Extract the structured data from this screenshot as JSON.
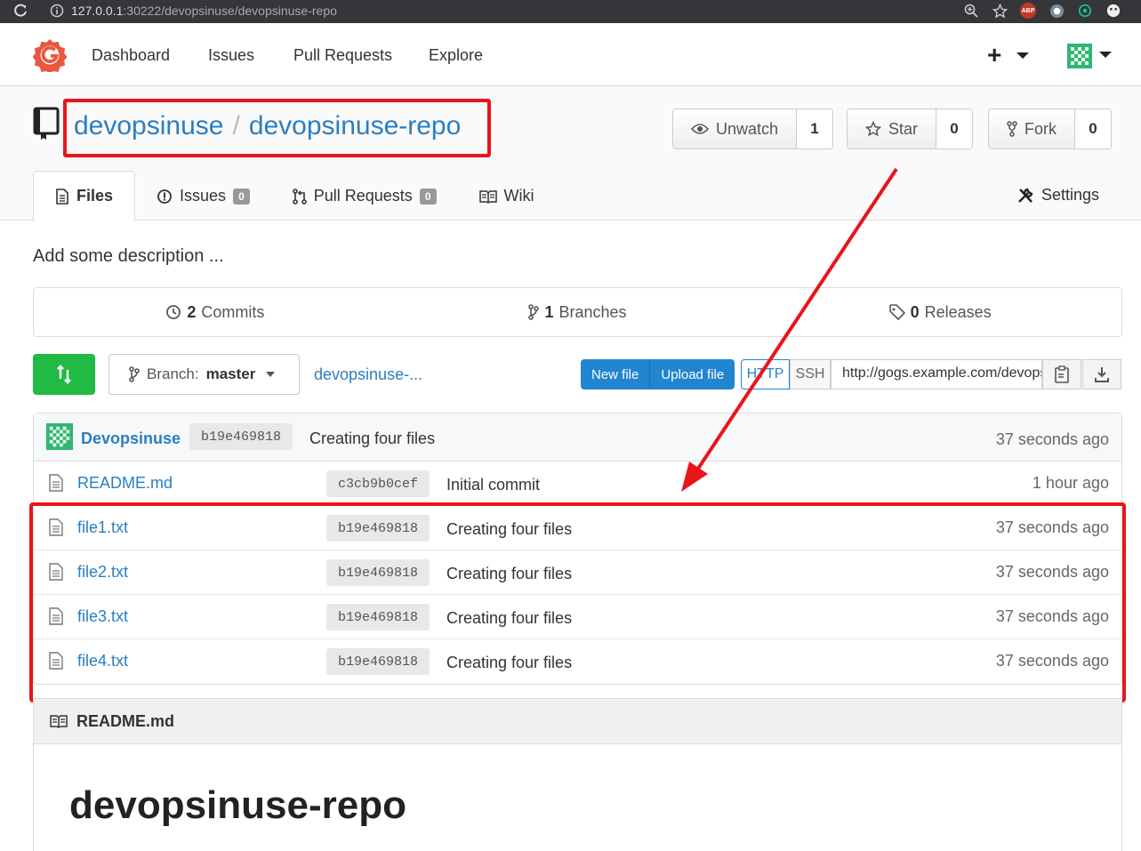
{
  "browser": {
    "url_host": "127.0.0.1",
    "url_path": ":30222/devopsinuse/devopsinuse-repo",
    "abp_label": "ABP"
  },
  "nav": {
    "items": [
      "Dashboard",
      "Issues",
      "Pull Requests",
      "Explore"
    ],
    "plus": "+"
  },
  "repo": {
    "owner": "devopsinuse",
    "separator": "/",
    "name": "devopsinuse-repo",
    "watch_label": "Unwatch",
    "watch_count": "1",
    "star_label": "Star",
    "star_count": "0",
    "fork_label": "Fork",
    "fork_count": "0"
  },
  "tabs": {
    "files": "Files",
    "issues": "Issues",
    "issues_count": "0",
    "pulls": "Pull Requests",
    "pulls_count": "0",
    "wiki": "Wiki",
    "settings": "Settings"
  },
  "description": "Add some description ...",
  "stats": {
    "commits_count": "2",
    "commits_label": "Commits",
    "branches_count": "1",
    "branches_label": "Branches",
    "releases_count": "0",
    "releases_label": "Releases"
  },
  "actions": {
    "branch_prefix": "Branch:",
    "branch_name": "master",
    "breadcrumb": "devopsinuse-...",
    "new_file": "New file",
    "upload_file": "Upload file",
    "http": "HTTP",
    "ssh": "SSH",
    "clone_url": "http://gogs.example.com/devopsinuse/devopsinuse-repo.git"
  },
  "latest_commit": {
    "author": "Devopsinuse",
    "sha": "b19e469818",
    "message": "Creating four files",
    "age": "37 seconds ago"
  },
  "files": [
    {
      "name": "README.md",
      "sha": "c3cb9b0cef",
      "message": "Initial commit",
      "age": "1 hour ago"
    },
    {
      "name": "file1.txt",
      "sha": "b19e469818",
      "message": "Creating four files",
      "age": "37 seconds ago"
    },
    {
      "name": "file2.txt",
      "sha": "b19e469818",
      "message": "Creating four files",
      "age": "37 seconds ago"
    },
    {
      "name": "file3.txt",
      "sha": "b19e469818",
      "message": "Creating four files",
      "age": "37 seconds ago"
    },
    {
      "name": "file4.txt",
      "sha": "b19e469818",
      "message": "Creating four files",
      "age": "37 seconds ago"
    }
  ],
  "readme": {
    "header": "README.md",
    "title": "devopsinuse-repo"
  },
  "colors": {
    "link": "#2a7ec1",
    "highlight": "#e8151b",
    "green": "#21ba45",
    "blue": "#2185d0"
  }
}
